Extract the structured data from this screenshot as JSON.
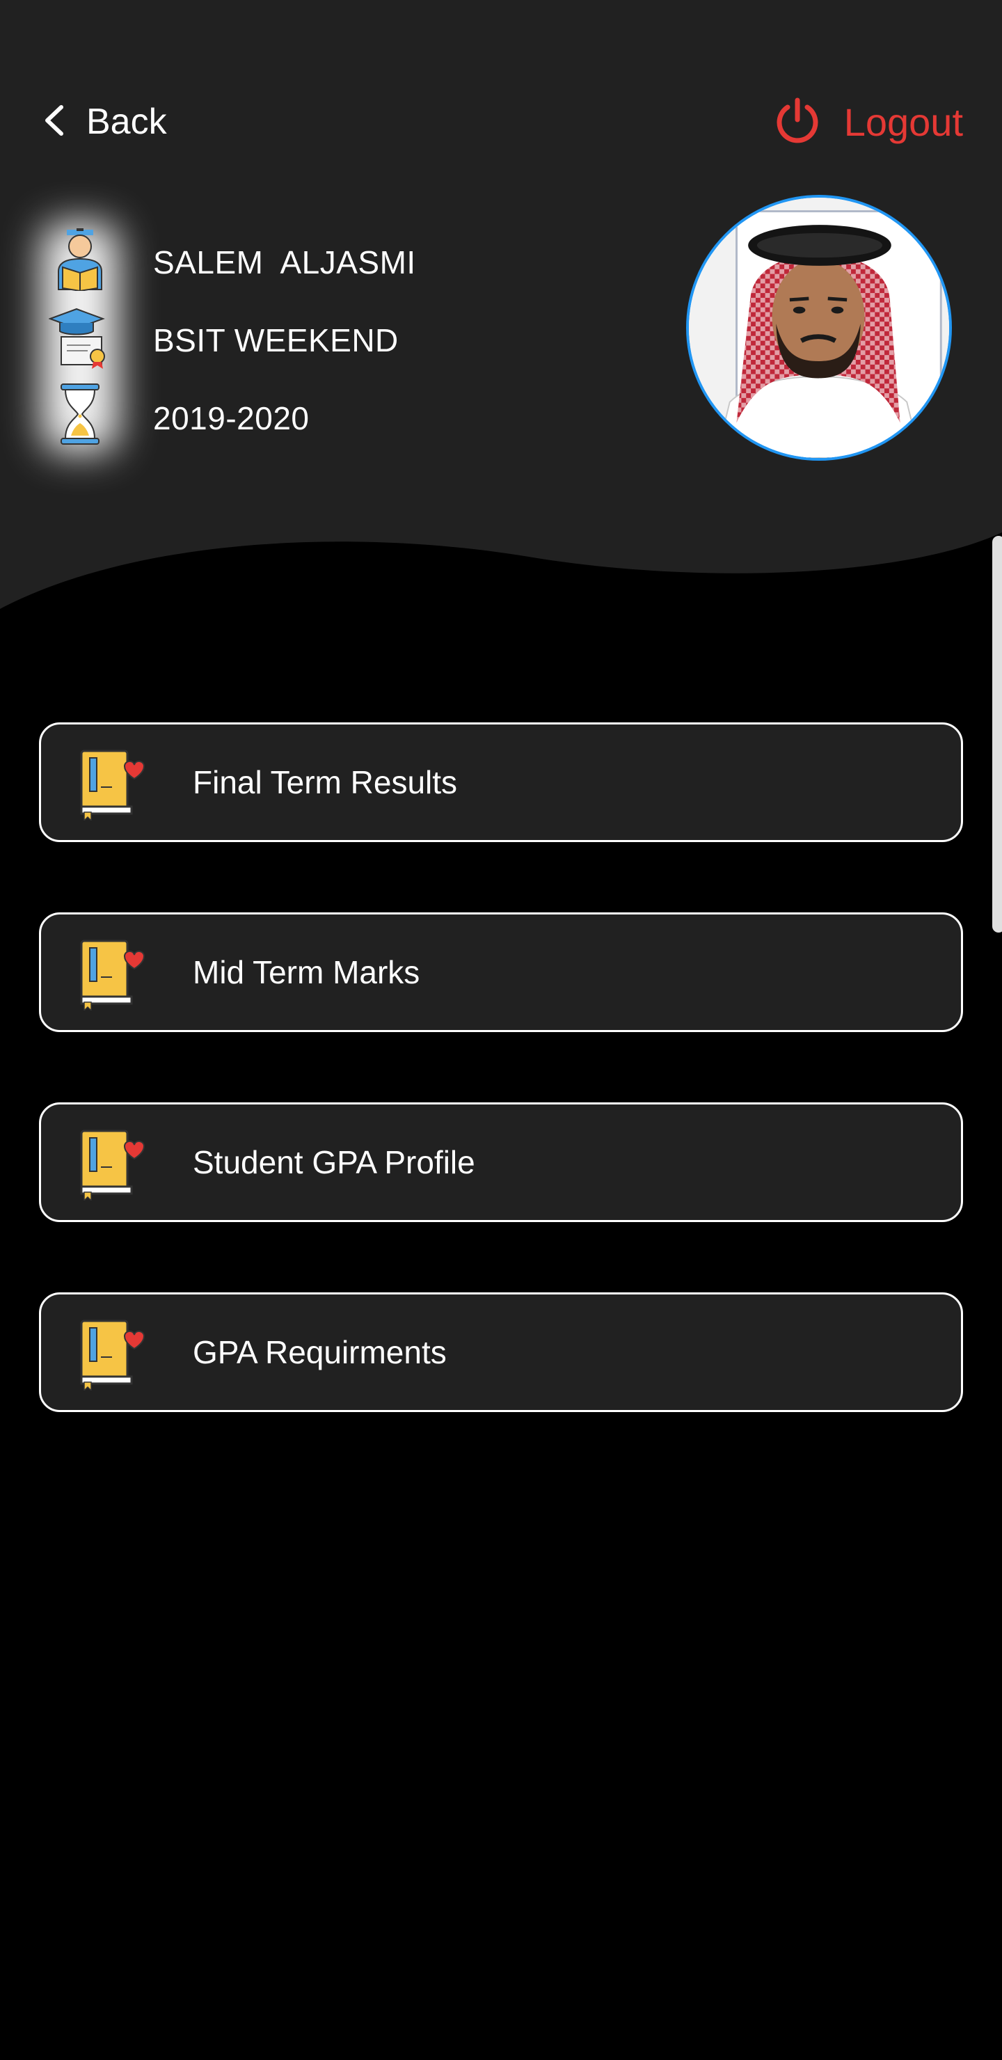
{
  "colors": {
    "header_bg": "#212121",
    "page_bg": "#000000",
    "logout": "#e53935",
    "avatar_ring": "#2196f3",
    "card_bg": "#212121",
    "card_border": "#ffffff"
  },
  "nav": {
    "back_label": "Back",
    "back_icon": "chevron-left-icon",
    "logout_label": "Logout",
    "logout_icon": "power-icon"
  },
  "student": {
    "name": "SALEM  ALJASMI",
    "program": "BSIT WEEKEND",
    "year": "2019-2020",
    "icons": [
      "student-icon",
      "diploma-icon",
      "hourglass-icon"
    ],
    "photo": "profile-photo"
  },
  "menu": [
    {
      "label": "Final Term Results",
      "icon": "book-heart-icon"
    },
    {
      "label": "Mid Term Marks",
      "icon": "book-heart-icon"
    },
    {
      "label": "Student GPA Profile",
      "icon": "book-heart-icon"
    },
    {
      "label": "GPA Requirments",
      "icon": "book-heart-icon"
    }
  ]
}
